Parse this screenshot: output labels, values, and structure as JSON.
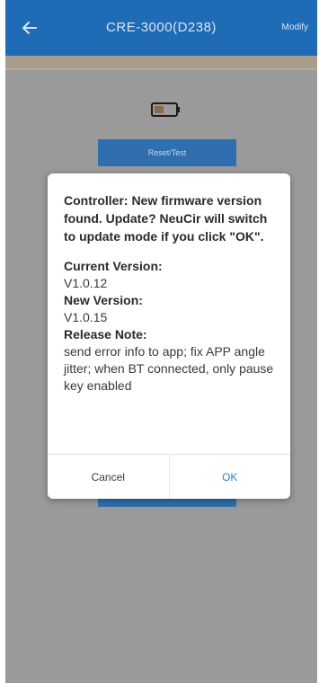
{
  "app_bar": {
    "title": "CRE-3000(D238)",
    "action_label": "Modify"
  },
  "background": {
    "top_button_label": "Reset/Test"
  },
  "dialog": {
    "title": "Controller: New firmware version found. Update? NeuCir will switch to update mode if you click \"OK\".",
    "current_version_label": "Current Version:",
    "current_version": "V1.0.12",
    "new_version_label": "New Version:",
    "new_version": "V1.0.15",
    "release_note_label": "Release Note:",
    "release_note": "send error info to app; fix APP angle jitter; when BT connected, only pause key enabled",
    "cancel_label": "Cancel",
    "ok_label": "OK"
  },
  "colors": {
    "app_bar": "#1f6bb5",
    "accent": "#2c7fca",
    "overlay": "#9a9a9a"
  }
}
